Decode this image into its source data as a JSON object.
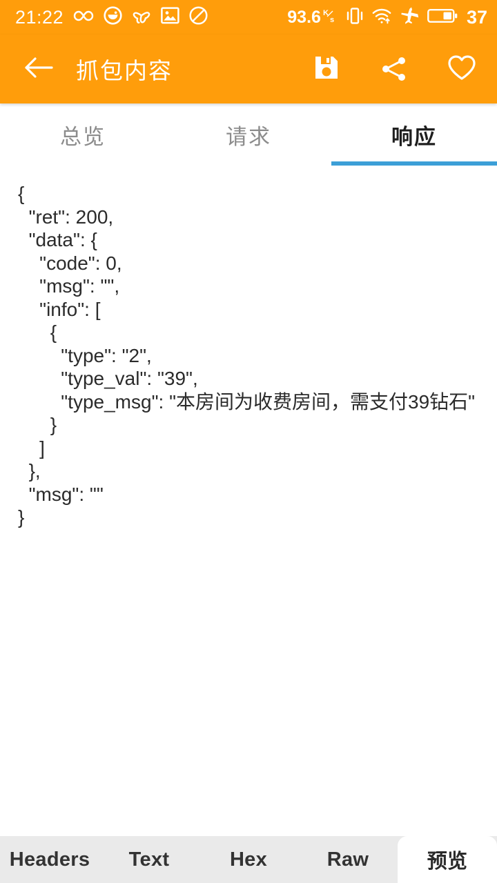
{
  "status_bar": {
    "time": "21:22",
    "left_icons": [
      "infinity-icon",
      "eye-circle-icon",
      "knot-icon",
      "gallery-icon",
      "do-not-disturb-icon"
    ],
    "network_speed": "93.6",
    "network_speed_unit_top": "K",
    "network_speed_unit_bottom": "s",
    "right_icons": [
      "vibrate-icon",
      "wifi-icon",
      "airplane-mode-icon",
      "battery-icon"
    ],
    "battery_level": "37",
    "background_color": "#FF9D0B",
    "foreground_color": "#FFFFFF"
  },
  "app_bar": {
    "title": "抓包内容",
    "back_icon": "back-arrow-icon",
    "actions": [
      {
        "name": "save-icon",
        "label": "保存"
      },
      {
        "name": "share-icon",
        "label": "分享"
      },
      {
        "name": "favorite-icon",
        "label": "收藏"
      }
    ],
    "background_color": "#FF9D0B"
  },
  "top_tabs": {
    "indicator_color": "#3C9FD7",
    "items": [
      {
        "label": "总览",
        "active": false
      },
      {
        "label": "请求",
        "active": false
      },
      {
        "label": "响应",
        "active": true
      }
    ]
  },
  "content": {
    "json_text": "{\n  \"ret\": 200,\n  \"data\": {\n    \"code\": 0,\n    \"msg\": \"\",\n    \"info\": [\n      {\n        \"type\": \"2\",\n        \"type_val\": \"39\",\n        \"type_msg\": \"本房间为收费房间，需支付39钻石\"\n      }\n    ]\n  },\n  \"msg\": \"\"\n}",
    "parsed": {
      "ret": 200,
      "data": {
        "code": 0,
        "msg": "",
        "info": [
          {
            "type": "2",
            "type_val": "39",
            "type_msg": "本房间为收费房间，需支付39钻石"
          }
        ]
      },
      "msg": ""
    }
  },
  "bottom_tabs": {
    "items": [
      {
        "label": "Headers",
        "active": false
      },
      {
        "label": "Text",
        "active": false
      },
      {
        "label": "Hex",
        "active": false
      },
      {
        "label": "Raw",
        "active": false
      },
      {
        "label": "预览",
        "active": true
      }
    ],
    "background_color": "#EAEAEA",
    "active_background_color": "#FFFFFF"
  }
}
